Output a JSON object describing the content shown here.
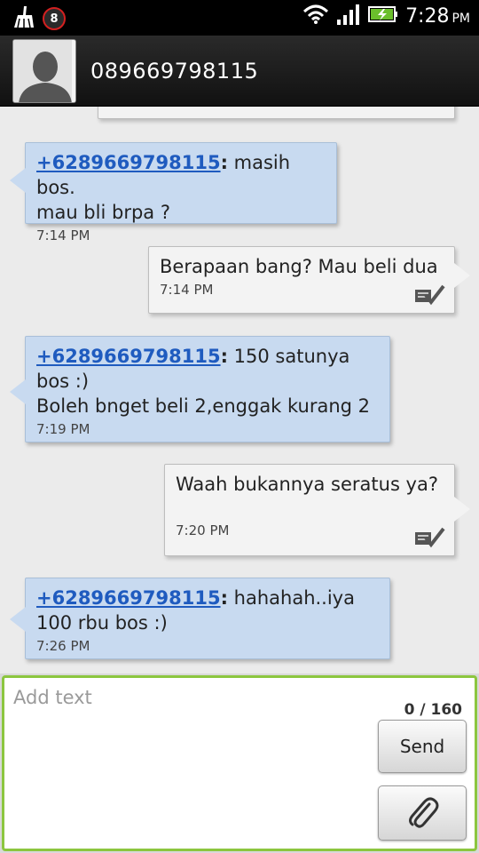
{
  "status_bar": {
    "notification_badge": "8",
    "time": "7:28",
    "ampm": "PM"
  },
  "header": {
    "title": "089669798115"
  },
  "messages": [
    {
      "direction": "in",
      "sender": "+6289669798115",
      "lines": [
        "masih bos.",
        "mau bli brpa ?"
      ],
      "time": "7:14 PM"
    },
    {
      "direction": "out",
      "lines": [
        "Berapaan bang? Mau beli dua"
      ],
      "time": "7:14 PM"
    },
    {
      "direction": "in",
      "sender": "+6289669798115",
      "lines": [
        "150 satunya",
        "bos :)",
        "Boleh bnget beli 2,enggak kurang 2"
      ],
      "time": "7:19 PM"
    },
    {
      "direction": "out",
      "lines": [
        "Waah bukannya seratus ya?"
      ],
      "time": "7:20 PM"
    },
    {
      "direction": "in",
      "sender": "+6289669798115",
      "lines": [
        "hahahah..iya",
        "100 rbu bos :)"
      ],
      "time": "7:26 PM"
    }
  ],
  "compose": {
    "placeholder": "Add text",
    "counter": "0 / 160",
    "send_label": "Send"
  },
  "colors": {
    "incoming_bubble": "#c8daf0",
    "outgoing_bubble": "#f3f3f3",
    "compose_border": "#8cc63f",
    "sender_link": "#1f5bbf"
  }
}
